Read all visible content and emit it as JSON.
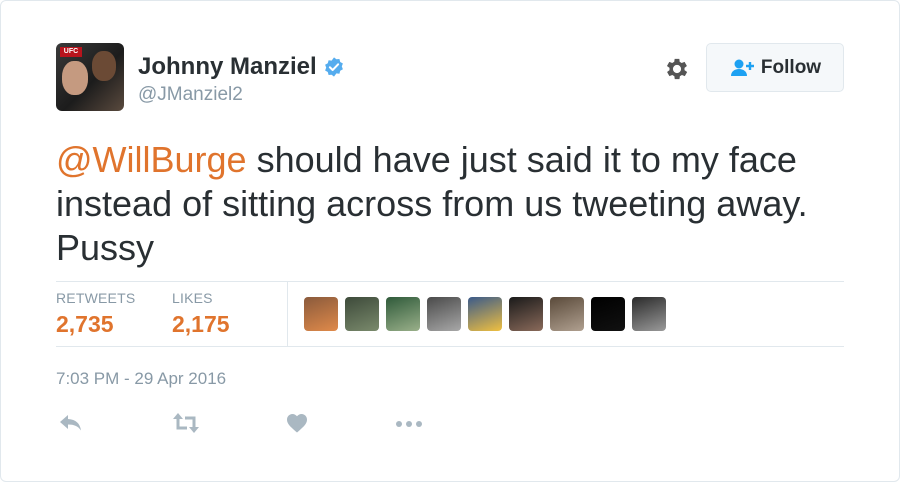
{
  "user": {
    "name": "Johnny Manziel",
    "handle": "@JManziel2",
    "avatar_badge": "UFC",
    "verified_icon": "verified-badge-icon"
  },
  "follow_button": {
    "label": "Follow",
    "icon": "add-user-icon"
  },
  "settings_icon": "gear-icon",
  "tweet": {
    "mention": "@WillBurge",
    "text_line1_rest": " should have just said it to my face",
    "text_line2": "instead of sitting across from us tweeting away.",
    "text_line3": "Pussy"
  },
  "stats": {
    "retweets_label": "RETWEETS",
    "retweets_value": "2,735",
    "likes_label": "LIKES",
    "likes_value": "2,175"
  },
  "likers": [
    {
      "name": "liker-avatar-1",
      "colors": [
        "#8a5a3c",
        "#e08a4a"
      ]
    },
    {
      "name": "liker-avatar-2",
      "colors": [
        "#3d4a3a",
        "#7a8a6c"
      ]
    },
    {
      "name": "liker-avatar-3",
      "colors": [
        "#2f5a3a",
        "#9ab08a"
      ]
    },
    {
      "name": "liker-avatar-4",
      "colors": [
        "#4a4a4a",
        "#a8a8a8"
      ]
    },
    {
      "name": "liker-avatar-5",
      "colors": [
        "#3a5a8a",
        "#f0c040"
      ]
    },
    {
      "name": "liker-avatar-6",
      "colors": [
        "#1a1a1a",
        "#8a6a5a"
      ]
    },
    {
      "name": "liker-avatar-7",
      "colors": [
        "#5a4a3a",
        "#b0a090"
      ]
    },
    {
      "name": "liker-avatar-8",
      "colors": [
        "#000000",
        "#111111"
      ]
    },
    {
      "name": "liker-avatar-9",
      "colors": [
        "#2a2a2a",
        "#9a9a9a"
      ]
    }
  ],
  "timestamp": "7:03 PM - 29 Apr 2016",
  "actions": [
    "reply-icon",
    "retweet-icon",
    "like-icon",
    "more-icon"
  ],
  "colors": {
    "accent": "#e0742d",
    "text": "#292f33",
    "muted": "#8899a6",
    "verified": "#55acee",
    "icon": "#aab8c2"
  }
}
